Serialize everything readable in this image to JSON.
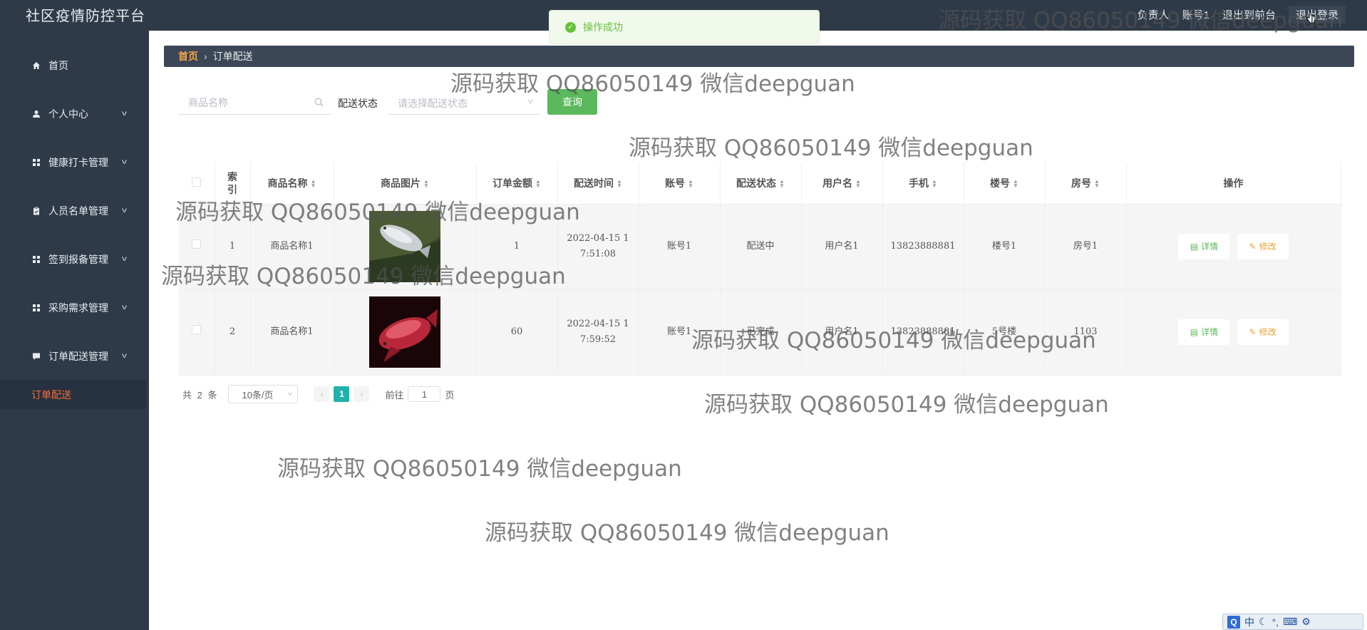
{
  "app": {
    "title": "社区疫情防控平台"
  },
  "topbar": {
    "role_text": "负责人",
    "account_text": "账号1",
    "back_front_label": "退出到前台",
    "logout_label": "退出登录"
  },
  "toast": {
    "message": "操作成功",
    "color": "#67c23a"
  },
  "sidebar": {
    "items": [
      {
        "label": "首页",
        "icon": "home-icon"
      },
      {
        "label": "个人中心",
        "icon": "user-icon"
      },
      {
        "label": "健康打卡管理",
        "icon": "grid-icon"
      },
      {
        "label": "人员名单管理",
        "icon": "clipboard-icon"
      },
      {
        "label": "签到报备管理",
        "icon": "grid-icon"
      },
      {
        "label": "采购需求管理",
        "icon": "grid-icon"
      },
      {
        "label": "订单配送管理",
        "icon": "chat-icon"
      }
    ],
    "active_sub": "订单配送",
    "active_color": "#f56c39"
  },
  "breadcrumb": {
    "home": "首页",
    "current": "订单配送"
  },
  "filters": {
    "search_placeholder": "商品名称",
    "status_label": "配送状态",
    "status_placeholder": "请选择配送状态",
    "query_label": "查询"
  },
  "table": {
    "headers": [
      "索引",
      "商品名称",
      "商品图片",
      "订单金额",
      "配送时间",
      "账号",
      "配送状态",
      "用户名",
      "手机",
      "楼号",
      "房号",
      "操作"
    ],
    "rows": [
      {
        "index": "1",
        "name": "商品名称1",
        "image": "fish-photo-1",
        "amount": "1",
        "time_line1": "2022-04-15 1",
        "time_line2": "7:51:08",
        "account": "账号1",
        "status": "配送中",
        "username": "用户名1",
        "phone": "13823888881",
        "building": "楼号1",
        "room": "房号1"
      },
      {
        "index": "2",
        "name": "商品名称1",
        "image": "fish-photo-2",
        "amount": "60",
        "time_line1": "2022-04-15 1",
        "time_line2": "7:59:52",
        "account": "账号1",
        "status": "已完成",
        "username": "用户名1",
        "phone": "13823888881",
        "building": "5号楼",
        "room": "1103"
      }
    ],
    "detail_label": "详情",
    "edit_label": "修改"
  },
  "pagination": {
    "total_text": "共 2 条",
    "page_size": "10条/页",
    "current_page": "1",
    "goto_prefix": "前往",
    "goto_value": "1",
    "goto_suffix": "页"
  },
  "watermark": "源码获取 QQ86050149 微信deepguan",
  "ime": {
    "mode": "中"
  }
}
